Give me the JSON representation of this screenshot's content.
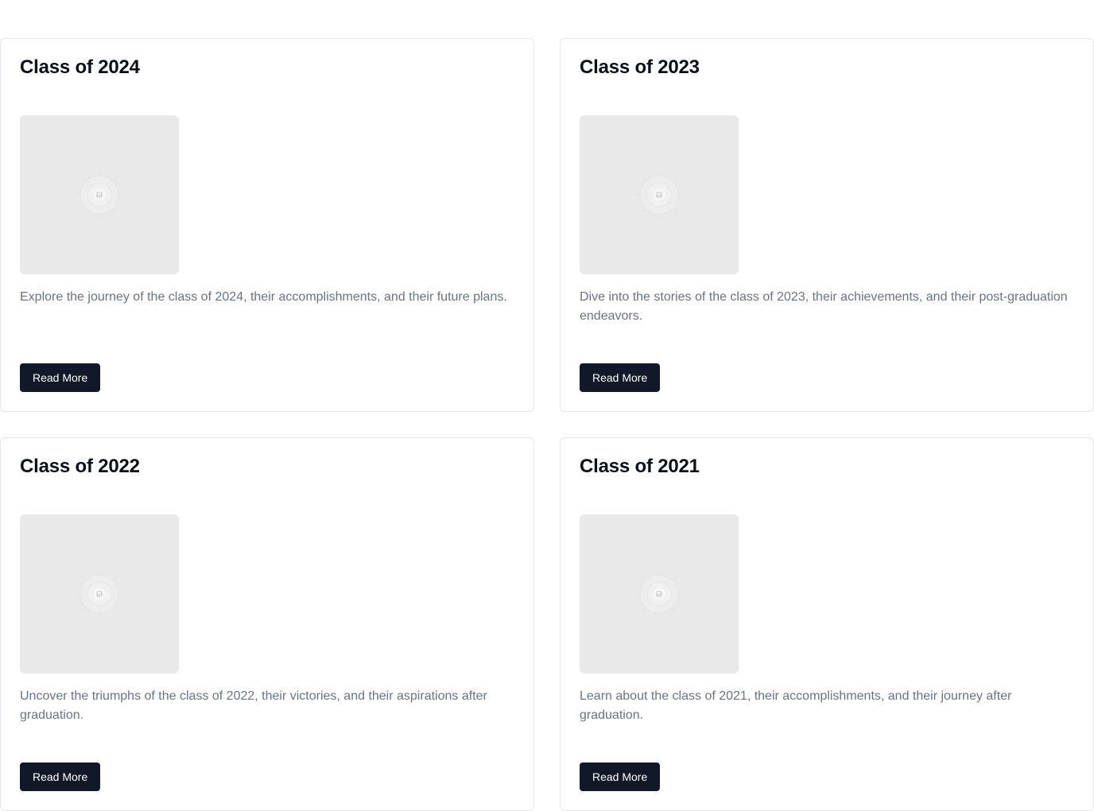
{
  "cards": [
    {
      "title": "Class of 2024",
      "description": "Explore the journey of the class of 2024, their accomplishments, and their future plans.",
      "button_label": "Read More",
      "image_icon": "image-placeholder-icon"
    },
    {
      "title": "Class of 2023",
      "description": "Dive into the stories of the class of 2023, their achievements, and their post-graduation endeavors.",
      "button_label": "Read More",
      "image_icon": "image-placeholder-icon"
    },
    {
      "title": "Class of 2022",
      "description": "Uncover the triumphs of the class of 2022, their victories, and their aspirations after graduation.",
      "button_label": "Read More",
      "image_icon": "image-placeholder-icon"
    },
    {
      "title": "Class of 2021",
      "description": "Learn about the class of 2021, their accomplishments, and their journey after graduation.",
      "button_label": "Read More",
      "image_icon": "image-placeholder-icon"
    }
  ],
  "colors": {
    "button_bg": "#111827",
    "button_text": "#ffffff",
    "title": "#0b0f17",
    "description": "#6b7280",
    "card_border": "#e5e7eb",
    "placeholder_bg": "#e9e9e9"
  }
}
